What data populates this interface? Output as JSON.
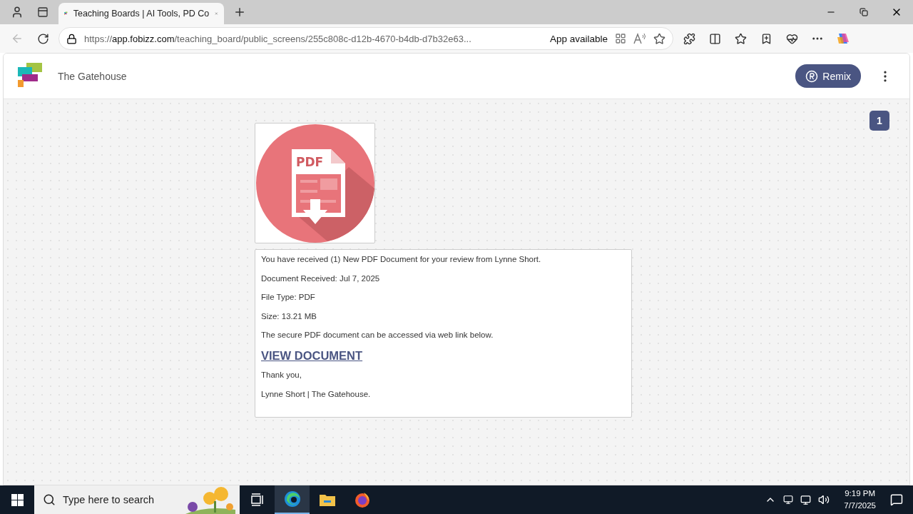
{
  "browser": {
    "tab": {
      "title": "Teaching Boards | AI Tools, PD Co",
      "selected": true
    },
    "address": {
      "url_prefix": "https://",
      "url_host": "app.fobizz.com",
      "url_path": "/teaching_board/public_screens/255c808c-d12b-4670-b4db-d7b32e63..."
    },
    "app_available": "App available"
  },
  "header": {
    "board_title": "The Gatehouse",
    "remix_button": "Remix"
  },
  "page_badge": "1",
  "pdf_image": {
    "label": "PDF"
  },
  "message": {
    "lines": [
      {
        "kind": "text",
        "text": "You have received (1) New PDF Document for your review from Lynne Short."
      },
      {
        "kind": "text",
        "text": "Document Received: Jul 7, 2025"
      },
      {
        "kind": "text",
        "text": "File Type: PDF"
      },
      {
        "kind": "text",
        "text": "Size: 13.21 MB"
      },
      {
        "kind": "text",
        "text": "The secure PDF document can be accessed via web link below."
      },
      {
        "kind": "link",
        "text": "VIEW DOCUMENT"
      },
      {
        "kind": "text",
        "text": "Thank you,"
      },
      {
        "kind": "text",
        "text": "Lynne Short | The Gatehouse."
      }
    ]
  },
  "taskbar": {
    "search_placeholder": "Type here to search",
    "time": "9:19 PM",
    "date": "7/7/2025"
  }
}
